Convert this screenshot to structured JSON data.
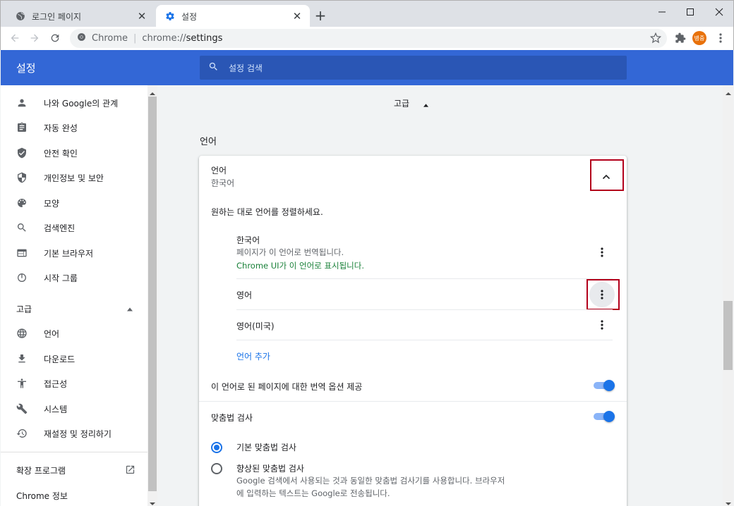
{
  "browser": {
    "tabs": [
      {
        "title": "로그인 페이지",
        "icon": "globe-icon",
        "active": false
      },
      {
        "title": "설정",
        "icon": "gear-icon",
        "active": true
      }
    ],
    "omnibox": {
      "site": "Chrome",
      "url_prefix": "chrome://",
      "url_host": "settings"
    },
    "profile_initials": "병중"
  },
  "settings": {
    "title": "설정",
    "search_placeholder": "설정 검색",
    "sidebar": {
      "items": [
        {
          "label": "나와 Google의 관계",
          "icon": "person-icon"
        },
        {
          "label": "자동 완성",
          "icon": "clipboard-icon"
        },
        {
          "label": "안전 확인",
          "icon": "shield-check-icon"
        },
        {
          "label": "개인정보 및 보안",
          "icon": "shield-icon"
        },
        {
          "label": "모양",
          "icon": "palette-icon"
        },
        {
          "label": "검색엔진",
          "icon": "search-icon"
        },
        {
          "label": "기본 브라우저",
          "icon": "browser-icon"
        },
        {
          "label": "시작 그룹",
          "icon": "power-icon"
        }
      ],
      "advanced_label": "고급",
      "advanced_items": [
        {
          "label": "언어",
          "icon": "globe-icon"
        },
        {
          "label": "다운로드",
          "icon": "download-icon"
        },
        {
          "label": "접근성",
          "icon": "accessibility-icon"
        },
        {
          "label": "시스템",
          "icon": "wrench-icon"
        },
        {
          "label": "재설정 및 정리하기",
          "icon": "history-icon"
        }
      ],
      "extensions_label": "확장 프로그램",
      "about_label": "Chrome 정보"
    },
    "main": {
      "advanced_toggle_label": "고급",
      "section_title": "언어",
      "language_card": {
        "title": "언어",
        "subtitle": "한국어",
        "order_hint": "원하는 대로 언어를 정렬하세요.",
        "languages": [
          {
            "name": "한국어",
            "line1": "페이지가 이 언어로 번역됩니다.",
            "line2": "Chrome UI가 이 언어로 표시됩니다."
          },
          {
            "name": "영어"
          },
          {
            "name": "영어(미국)"
          }
        ],
        "add_language": "언어 추가",
        "translate_offer": {
          "label": "이 언어로 된 페이지에 대한 번역 옵션 제공",
          "enabled": true
        }
      },
      "spellcheck": {
        "label": "맞춤법 검사",
        "enabled": true,
        "options": [
          {
            "label": "기본 맞춤법 검사",
            "checked": true
          },
          {
            "label": "향상된 맞춤법 검사",
            "checked": false,
            "desc_line1": "Google 검색에서 사용되는 것과 동일한 맞춤법 검사기를 사용합니다. 브라우저",
            "desc_line2": "에 입력하는 텍스트는 Google로 전송됩니다."
          }
        ]
      }
    }
  },
  "colors": {
    "header": "#3367d6",
    "accent": "#1a73e8",
    "highlight": "#b3001b",
    "green": "#188038"
  }
}
